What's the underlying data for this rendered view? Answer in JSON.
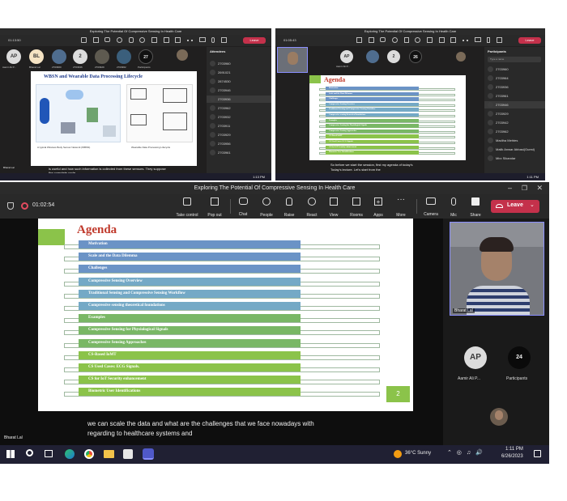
{
  "meeting_title": "Exploring The Potential Of Compressive Sensing In Health Care",
  "timer": "01:02:54",
  "toolbar": {
    "take_control": "Take control",
    "pop_out": "Pop out",
    "chat": "Chat",
    "people": "People",
    "raise": "Raise",
    "react": "React",
    "view": "View",
    "rooms": "Rooms",
    "apps": "Apps",
    "more": "More",
    "camera": "Camera",
    "mic": "Mic",
    "share": "Share",
    "leave": "Leave"
  },
  "slide": {
    "title": "Agenda",
    "page_number": "2",
    "items": [
      "Motivation",
      "Scale and the Data Dilemma",
      "Challenges",
      "Compressive Sensing Overview",
      "Traditional Sensing and Compressive Sensing Workflow",
      "Compressive sensing theoretical foundations",
      "Examples",
      "Compressive Sensing for Physiological Signals",
      "Compressive Sensing Approaches",
      "CS-Based IoMT",
      "CS Used Cases: ECG Signals.",
      "CS for IoT Security enhancement",
      "Biometric User Identifications"
    ]
  },
  "captions": {
    "line1": "we can scale the data and what are the challenges that we face nowadays with",
    "line2": "regarding to healthcare systems and"
  },
  "presenter_name": "Bharat Lal",
  "side_panel": {
    "avatar_initials": "AP",
    "avatar_name": "Aamir Ali P...",
    "participants_count": "24",
    "participants_label": "Participants"
  },
  "taskbar": {
    "weather": "36°C  Sunny",
    "time": "1:11 PM",
    "date": "6/26/2023"
  },
  "top_left": {
    "timer": "01:13:50",
    "slide_title": "WBSN and Wearable Data Processing Lifecycle",
    "caption_fig1": "A typical Wireless Body Sensor Network (WBSN).",
    "caption_fig2": "Wearable Data Processing Lifecycle",
    "subtitle1": "is useful and how such information is collected from these sensors. They suppose",
    "subtitle2": "the complete cycle",
    "avatars": [
      "AP",
      "BL",
      "",
      "2",
      "",
      "",
      "27"
    ],
    "avatar_labels": [
      "Aamir Ali P...",
      "Bharat Lal",
      "2703960",
      "2703936",
      "2703929",
      "2703962",
      "Participants"
    ],
    "attendees_label": "Attendees",
    "attendees": [
      "2703960",
      "2691021",
      "2874530",
      "2703946",
      "2703936",
      "2703962",
      "2703932",
      "2703911",
      "2703929",
      "2703956",
      "2703961"
    ],
    "clock": "1:13 PM"
  },
  "top_right": {
    "timer": "01:05:43",
    "slide_title": "Agenda",
    "avatar_labels": [
      "Aamir Ali P...",
      "",
      "2",
      "",
      ""
    ],
    "subtitle1": "So before we start the session, first my agenda of today's",
    "subtitle2": "Today's lecture. Let's start from the",
    "participants_label": "Participants",
    "search_placeholder": "Type a name",
    "people": [
      "2703960",
      "2703964",
      "2703936",
      "2703961",
      "2703946",
      "2703929",
      "2703942",
      "2703962",
      "Madiha Mehtes",
      "Malik Anwar Abbasi(Guest)",
      "Mirz Sikandar"
    ],
    "clock": "1:11 PM"
  }
}
